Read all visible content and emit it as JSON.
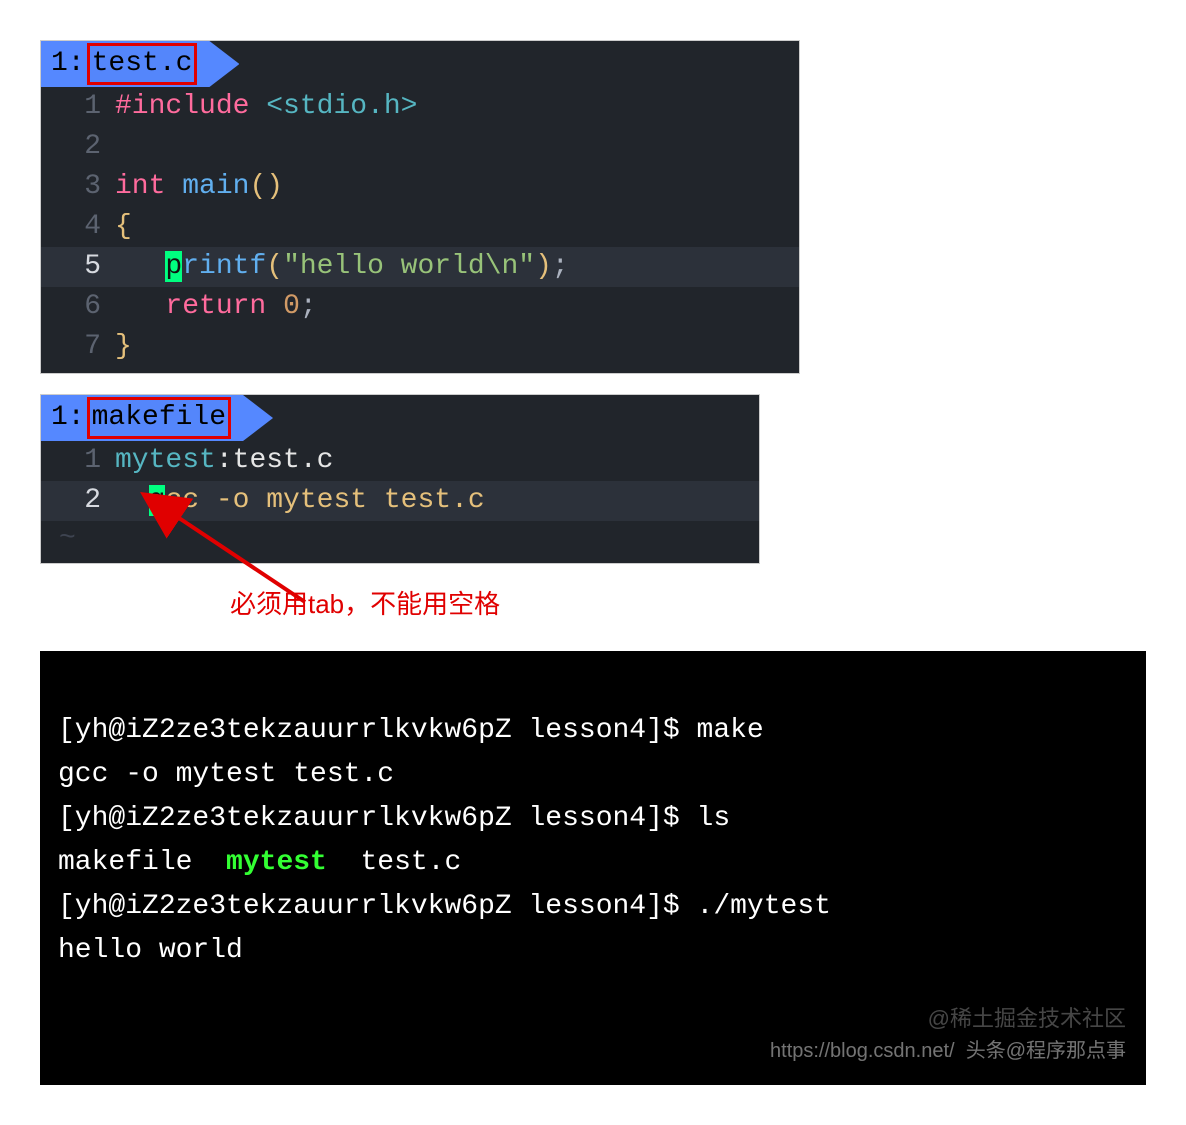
{
  "editor1": {
    "tab_index": "1:",
    "tab_name": "test.c",
    "lines": {
      "l1": {
        "n": "1",
        "pre": "#include",
        "inc": "<stdio.h>"
      },
      "l2": {
        "n": "2"
      },
      "l3": {
        "n": "3",
        "type": "int",
        "func": "main",
        "paren": "()"
      },
      "l4": {
        "n": "4",
        "brace": "{"
      },
      "l5": {
        "n": "5",
        "indent": "   ",
        "cursor": "p",
        "func": "rintf",
        "open": "(",
        "str": "\"hello world\\n\"",
        "close": ")",
        "semi": ";"
      },
      "l6": {
        "n": "6",
        "indent": "   ",
        "kw": "return",
        "sp": " ",
        "num": "0",
        "semi": ";"
      },
      "l7": {
        "n": "7",
        "brace": "}"
      }
    }
  },
  "editor2": {
    "tab_index": "1:",
    "tab_name": "makefile",
    "lines": {
      "l1": {
        "n": "1",
        "target": "mytest",
        "colon": ":",
        "dep": "test.c"
      },
      "l2": {
        "n": "2",
        "indent": "  ",
        "cursor": "g",
        "cmd": "cc -o mytest test.c"
      }
    }
  },
  "caption": "必须用tab，不能用空格",
  "terminal": {
    "p1": "[yh@iZ2ze3tekzauurrlkvkw6pZ lesson4]$ ",
    "c1": "make",
    "o1": "gcc -o mytest test.c",
    "p2": "[yh@iZ2ze3tekzauurrlkvkw6pZ lesson4]$ ",
    "c2": "ls",
    "ls_a": "makefile  ",
    "ls_b": "mytest",
    "ls_c": "  test.c",
    "p3": "[yh@iZ2ze3tekzauurrlkvkw6pZ lesson4]$ ",
    "c3": "./mytest",
    "o3": "hello world"
  },
  "watermarks": {
    "w1": "@稀土掘金技术社区",
    "w2": "https://blog.csdn.net/  头条@程序那点事"
  }
}
